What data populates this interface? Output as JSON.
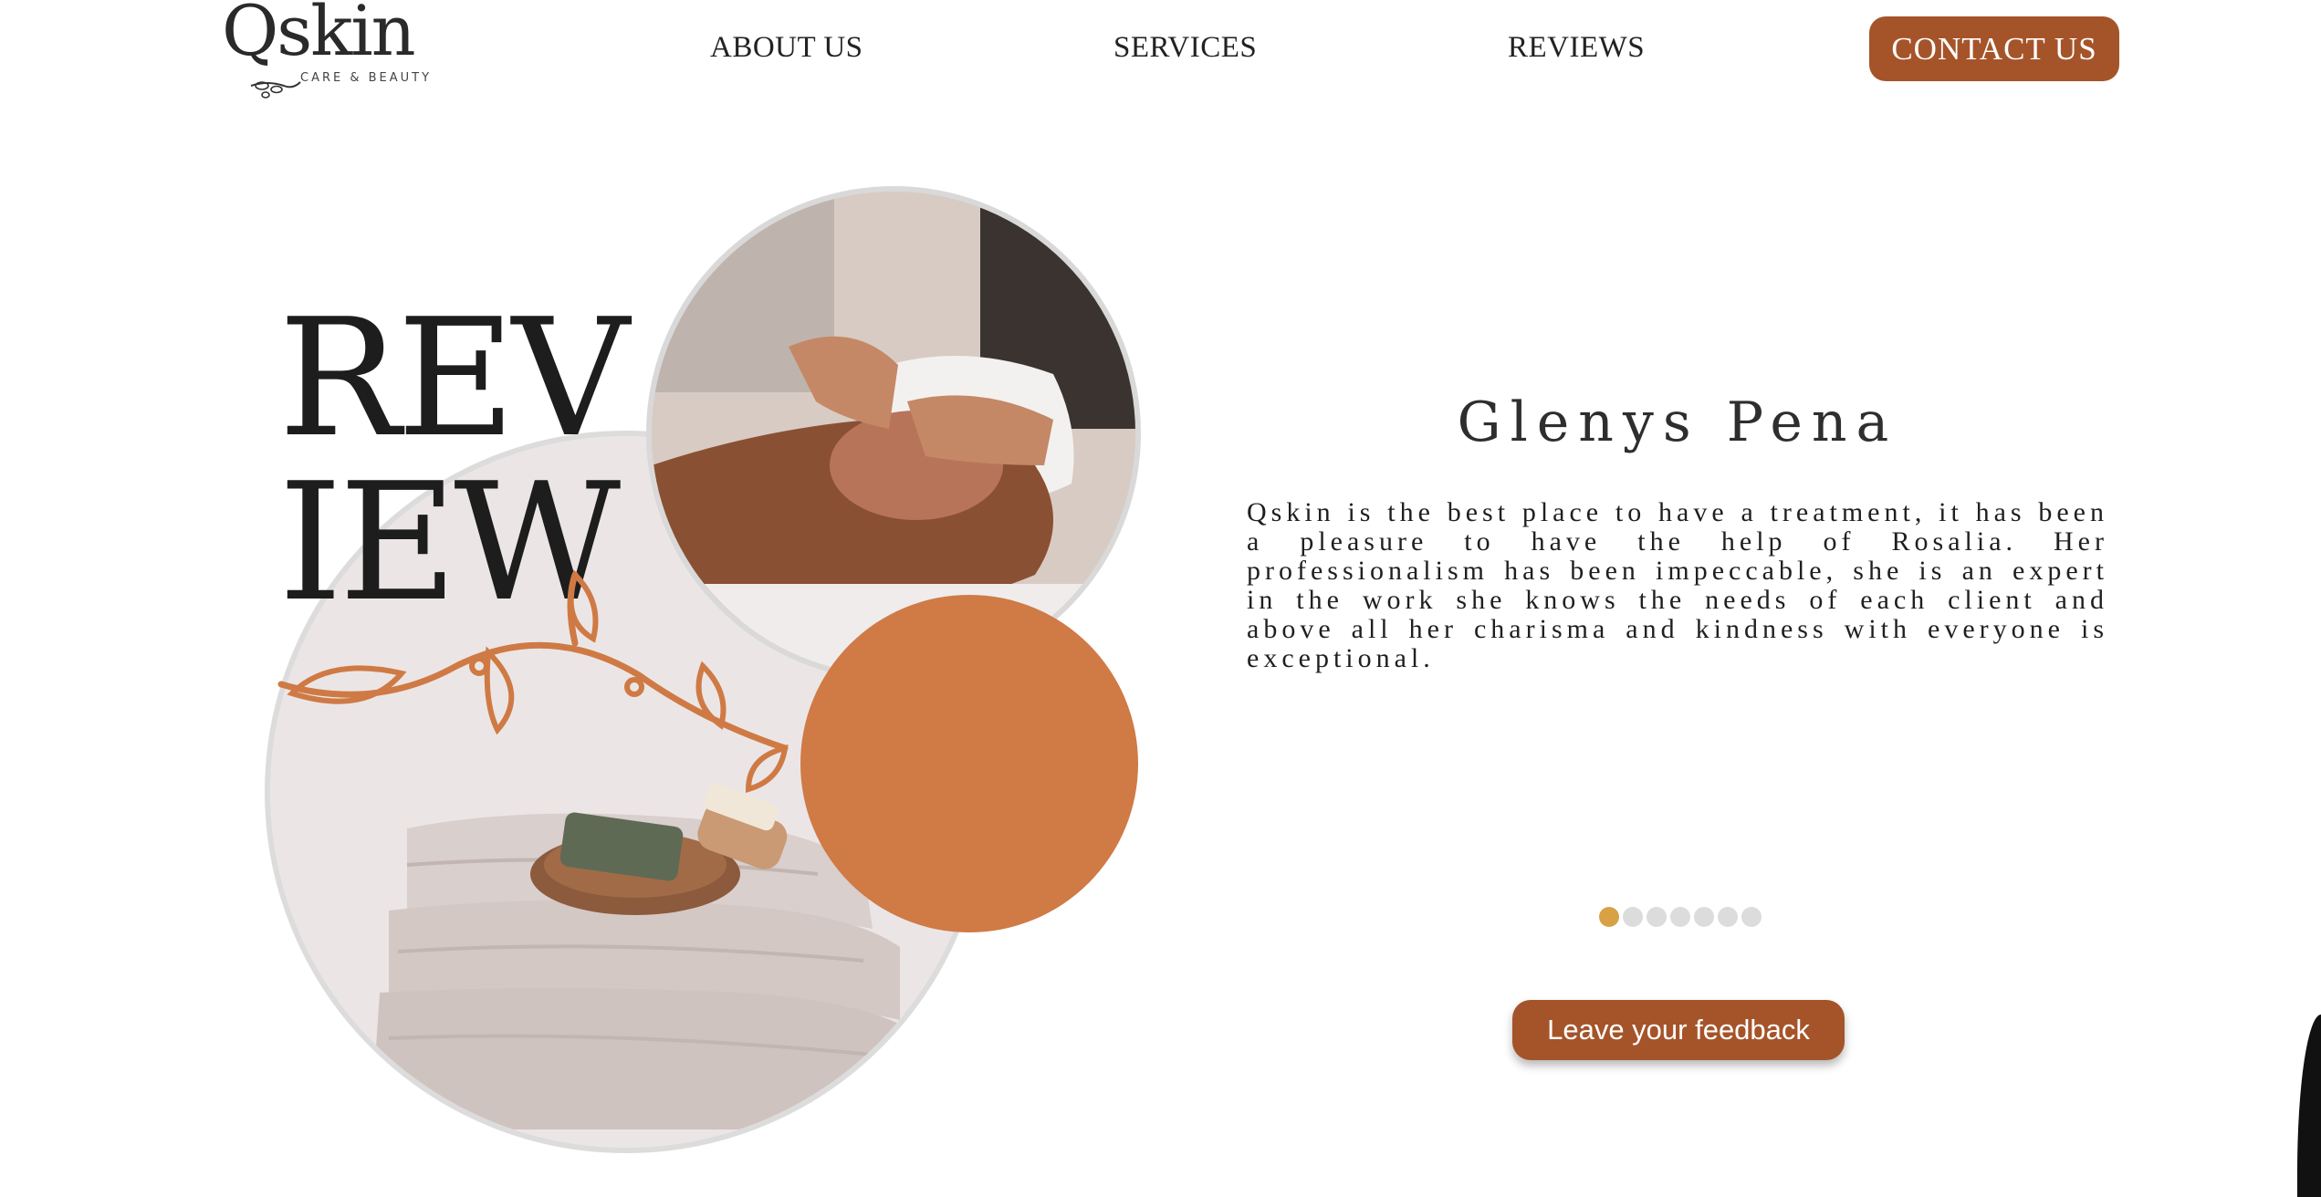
{
  "nav": {
    "logo_text": "Qskin",
    "logo_tagline": "CARE & BEAUTY",
    "links": [
      "ABOUT US",
      "SERVICES",
      "REVIEWS"
    ],
    "contact_label": "CONTACT US"
  },
  "hero": {
    "headline_line1": "REV",
    "headline_line2": "IEW"
  },
  "review": {
    "name": "Glenys Pena",
    "text": "Qskin is the best place to have a treatment, it has been a pleasure to have the help of Rosalia. Her professionalism has been impeccable, she is an expert in the work she knows the needs of each client and above all her charisma and kindness with everyone is exceptional.",
    "carousel_total": 7,
    "carousel_active": 1
  },
  "feedback_button_label": "Leave your feedback",
  "colors": {
    "brand": "#a5542a",
    "orange_circle": "#d07a46",
    "active_dot": "#d8a144",
    "inactive_dot": "#dcdcdc"
  }
}
